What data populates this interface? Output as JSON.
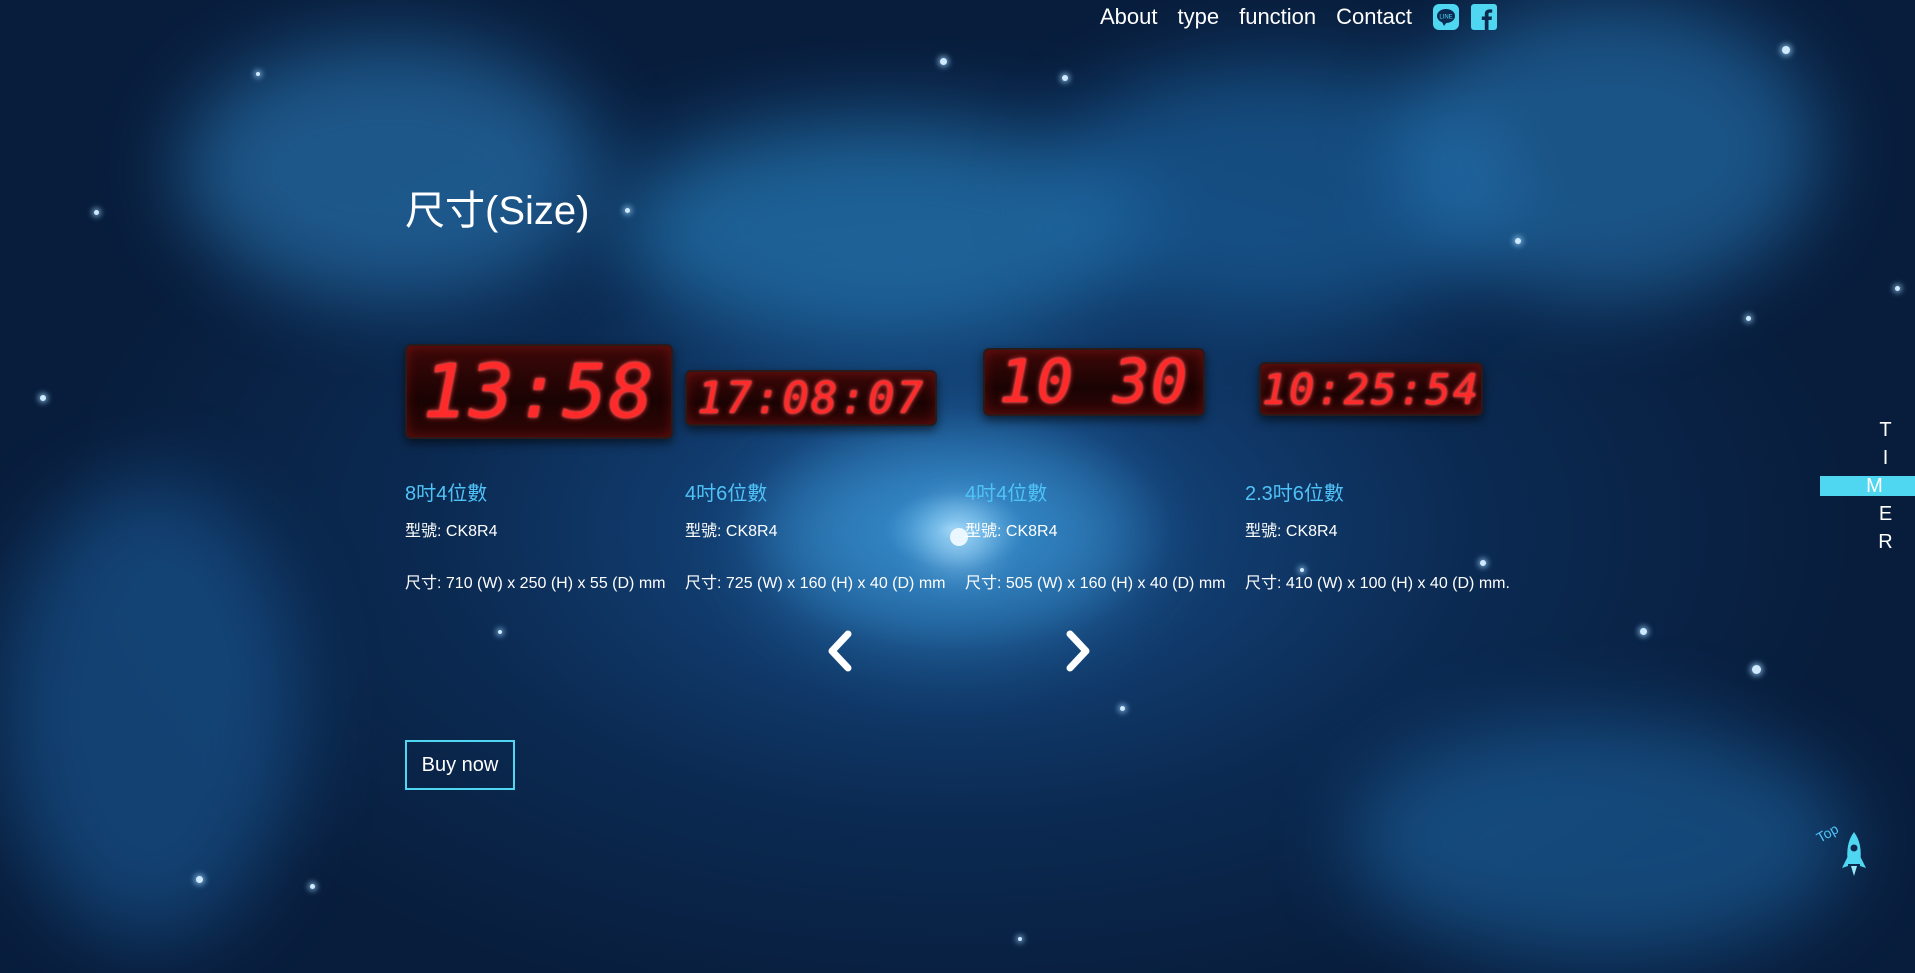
{
  "nav": {
    "items": [
      "About",
      "type",
      "function",
      "Contact"
    ],
    "line_icon": "line-icon",
    "facebook_icon": "facebook-icon"
  },
  "section_title": "尺寸(Size)",
  "products": [
    {
      "display": "13:58",
      "name": "8吋4位數",
      "model": "型號: CK8R4",
      "size": "尺寸: 710 (W) x 250 (H) x 55 (D) mm"
    },
    {
      "display": "17:08:07",
      "name": "4吋6位數",
      "model": "型號: CK8R4",
      "size": "尺寸: 725 (W) x 160 (H) x 40 (D) mm"
    },
    {
      "display": "10 30",
      "name": "4吋4位數",
      "model": "型號: CK8R4",
      "size": "尺寸: 505 (W) x 160 (H) x 40 (D) mm"
    },
    {
      "display": "10:25:54",
      "name": "2.3吋6位數",
      "model": "型號: CK8R4",
      "size": "尺寸: 410 (W) x 100 (H) x 40 (D) mm."
    }
  ],
  "carousel": {
    "prev_icon": "chevron-left-icon",
    "next_icon": "chevron-right-icon"
  },
  "buy_label": "Buy now",
  "side_timer": [
    "T",
    "I",
    "M",
    "E",
    "R"
  ],
  "top_label": "Top",
  "colors": {
    "accent": "#4fd6f0",
    "product_name": "#4fc3f7",
    "led": "#ff2b2b"
  }
}
